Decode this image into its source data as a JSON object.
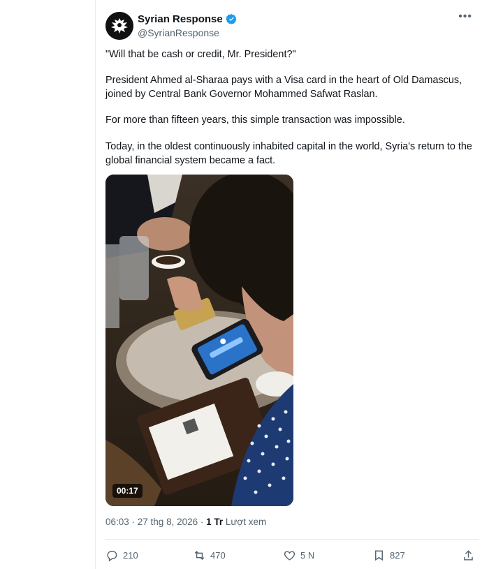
{
  "author": {
    "display_name": "Syrian Response",
    "handle": "@SyrianResponse",
    "verified": true
  },
  "post": {
    "paragraphs": [
      "\"Will that be cash or credit, Mr. President?\"",
      "President Ahmed al-Sharaa pays with a Visa card in the heart of Old Damascus, joined by Central Bank Governor Mohammed Safwat Raslan.",
      "For more than fifteen years, this simple transaction was impossible.",
      "Today, in the oldest continuously inhabited capital in the world, Syria's return to the global financial system became a fact."
    ],
    "video": {
      "duration": "00:17"
    },
    "meta": {
      "time_date": "06:03 · 27 thg 8, 2026 · ",
      "views_count": "1 Tr",
      "views_label": " Lượt xem"
    }
  },
  "actions": {
    "reply_count": "210",
    "repost_count": "470",
    "like_count": "5 N",
    "bookmark_count": "827"
  },
  "icons": [
    "eagle-logo-icon",
    "verified-badge-icon",
    "more-icon",
    "reply-icon",
    "repost-icon",
    "like-icon",
    "bookmark-icon",
    "share-icon"
  ],
  "colors": {
    "verified_blue": "#1d9bf0",
    "text_primary": "#0f1419",
    "text_secondary": "#536471"
  }
}
